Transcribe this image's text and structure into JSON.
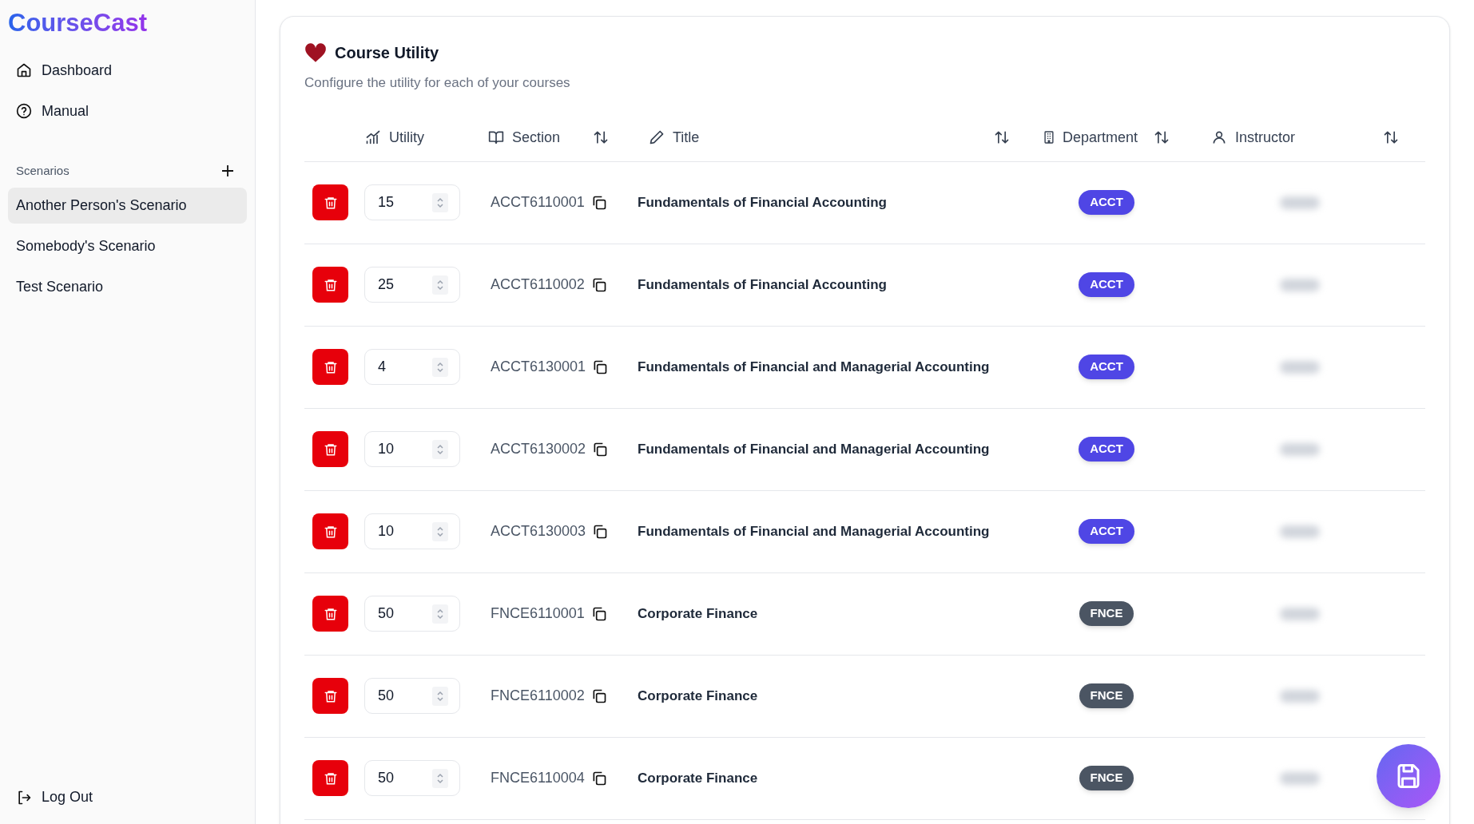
{
  "brand": "CourseCast",
  "nav": [
    {
      "kind": "home",
      "label": "Dashboard"
    },
    {
      "kind": "help",
      "label": "Manual"
    }
  ],
  "scenarios": {
    "heading": "Scenarios",
    "items": [
      {
        "label": "Another Person's Scenario",
        "selected": true
      },
      {
        "label": "Somebody's Scenario",
        "selected": false
      },
      {
        "label": "Test Scenario",
        "selected": false
      }
    ]
  },
  "logout": {
    "label": "Log Out"
  },
  "card": {
    "title": "Course Utility",
    "subtitle": "Configure the utility for each of your courses"
  },
  "table": {
    "columns": [
      {
        "kind": "utility",
        "label": "Utility",
        "sortable": false
      },
      {
        "kind": "section",
        "label": "Section",
        "sortable": true
      },
      {
        "kind": "title",
        "label": "Title",
        "sortable": true
      },
      {
        "kind": "department",
        "label": "Department",
        "sortable": true
      },
      {
        "kind": "instructor",
        "label": "Instructor",
        "sortable": true
      }
    ],
    "rows": [
      {
        "utility": "15",
        "section": "ACCT6110001",
        "title": "Fundamentals of Financial Accounting",
        "department": "ACCT",
        "color": "#4f46e5"
      },
      {
        "utility": "25",
        "section": "ACCT6110002",
        "title": "Fundamentals of Financial Accounting",
        "department": "ACCT",
        "color": "#4f46e5"
      },
      {
        "utility": "4",
        "section": "ACCT6130001",
        "title": "Fundamentals of Financial and Managerial Accounting",
        "department": "ACCT",
        "color": "#4f46e5"
      },
      {
        "utility": "10",
        "section": "ACCT6130002",
        "title": "Fundamentals of Financial and Managerial Accounting",
        "department": "ACCT",
        "color": "#4f46e5"
      },
      {
        "utility": "10",
        "section": "ACCT6130003",
        "title": "Fundamentals of Financial and Managerial Accounting",
        "department": "ACCT",
        "color": "#4f46e5"
      },
      {
        "utility": "50",
        "section": "FNCE6110001",
        "title": "Corporate Finance",
        "department": "FNCE",
        "color": "#4b5563"
      },
      {
        "utility": "50",
        "section": "FNCE6110002",
        "title": "Corporate Finance",
        "department": "FNCE",
        "color": "#4b5563"
      },
      {
        "utility": "50",
        "section": "FNCE6110004",
        "title": "Corporate Finance",
        "department": "FNCE",
        "color": "#4b5563"
      }
    ]
  }
}
